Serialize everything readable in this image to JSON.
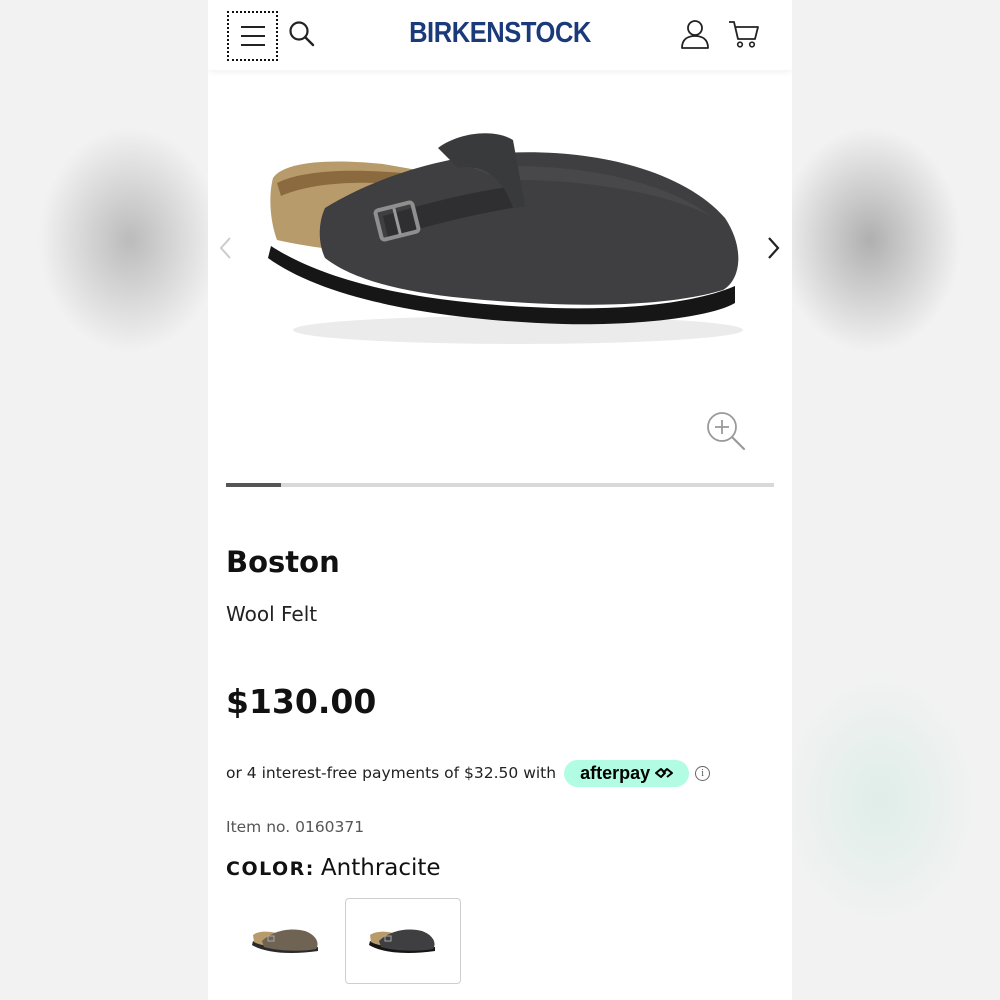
{
  "header": {
    "menu_icon": "hamburger-menu-icon",
    "search_icon": "search-icon",
    "brand": "BIRKENSTOCK",
    "account_icon": "user-icon",
    "cart_icon": "cart-icon",
    "brand_color": "#1b3a7a"
  },
  "gallery": {
    "prev_icon": "chevron-left-icon",
    "next_icon": "chevron-right-icon",
    "zoom_icon": "zoom-in-icon",
    "current_slide_fraction": 0.1,
    "progress_color": "#555555"
  },
  "product": {
    "name": "Boston",
    "material": "Wool Felt",
    "price": "$130.00",
    "installments_text": "or 4 interest-free payments of $32.50 with",
    "afterpay_label": "afterpay",
    "afterpay_color": "#b2fce4",
    "info_symbol": "i",
    "item_number": "Item no. 0160371",
    "color_label": "COLOR:",
    "color_value": "Anthracite"
  },
  "swatches": [
    {
      "name": "mocha",
      "selected": false
    },
    {
      "name": "anthracite",
      "selected": true
    }
  ]
}
